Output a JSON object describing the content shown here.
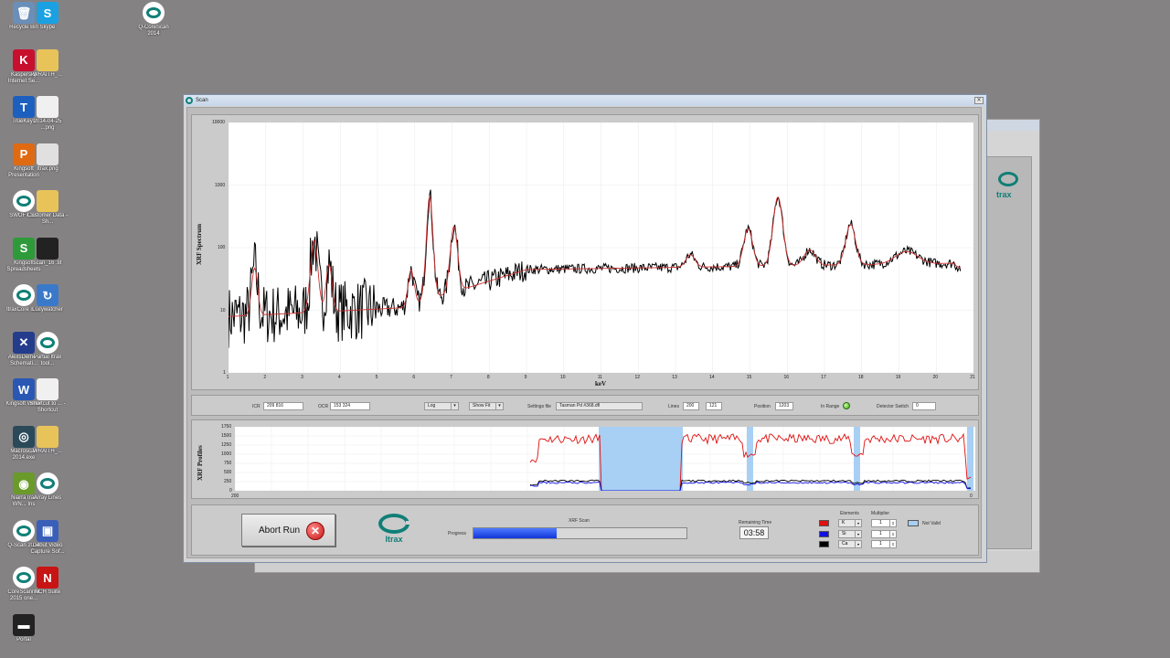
{
  "desktop": {
    "icons": [
      {
        "label": "Recycle Bin",
        "color": "#6a8fb8",
        "glyph": "🗑"
      },
      {
        "label": "Skype",
        "color": "#1ba1e2",
        "glyph": "S"
      },
      {
        "label": "Q-CoreScan 2014",
        "color": "itrax",
        "glyph": ""
      },
      {
        "label": "Kaspersky Internet Se...",
        "color": "#c8102e",
        "glyph": "K"
      },
      {
        "label": "WRAITH_...",
        "color": "#e7c35a",
        "glyph": ""
      },
      {
        "label": "TrueKeys",
        "color": "#1d5fbf",
        "glyph": "T"
      },
      {
        "label": "2014-04-25 ...png",
        "color": "#f0f0f0",
        "glyph": ""
      },
      {
        "label": "Kingsoft Presentation",
        "color": "#e06a12",
        "glyph": "P"
      },
      {
        "label": "Itrax.png",
        "color": "#e0e0e0",
        "glyph": ""
      },
      {
        "label": "SWOFT 3.0",
        "color": "itrax",
        "glyph": ""
      },
      {
        "label": "Customer Data - Sh...",
        "color": "#e7c35a",
        "glyph": ""
      },
      {
        "label": "Kingsoft Spreadsheets",
        "color": "#2e9a3a",
        "glyph": "S"
      },
      {
        "label": "scan_16 .tif",
        "color": "#222222",
        "glyph": ""
      },
      {
        "label": "ItraxCore 8.07",
        "color": "itrax",
        "glyph": ""
      },
      {
        "label": "Lucywatcher",
        "color": "#3a79c9",
        "glyph": "↻"
      },
      {
        "label": "AlexsDemo - Schemati...",
        "color": "#233c8c",
        "glyph": "✕"
      },
      {
        "label": "Partial Itrax tool...",
        "color": "itrax",
        "glyph": ""
      },
      {
        "label": "Kingsoft Writer",
        "color": "#2a57b4",
        "glyph": "W"
      },
      {
        "label": "Shortcut to ... - Shortcut",
        "color": "#f0f0f0",
        "glyph": ""
      },
      {
        "label": "Macroscan 2014.exe",
        "color": "#2a4a5a",
        "glyph": "◎"
      },
      {
        "label": "WRAITH_...",
        "color": "#e7c35a",
        "glyph": ""
      },
      {
        "label": "NiarraTrail WN... Ins",
        "color": "#6a9a2a",
        "glyph": "◉"
      },
      {
        "label": "Array Lines",
        "color": "itrax",
        "glyph": ""
      },
      {
        "label": "Q-Scan 2014",
        "color": "itrax",
        "glyph": ""
      },
      {
        "label": "Debut Video Capture Sof...",
        "color": "#3a5fb9",
        "glyph": "▣"
      },
      {
        "label": "CoreScanner 2015 one...",
        "color": "itrax",
        "glyph": ""
      },
      {
        "label": "NCH Suite",
        "color": "#c81414",
        "glyph": "N"
      },
      {
        "label": "Portal",
        "color": "#222222",
        "glyph": "▬"
      }
    ]
  },
  "window": {
    "title": "Scan",
    "close_glyph": "✕"
  },
  "spectrum": {
    "ylabel": "XRF Spectrum",
    "xlabel": "keV",
    "y_ticks": [
      "10000",
      "1000",
      "100",
      "10",
      "1"
    ],
    "x_ticks": [
      "1",
      "2",
      "3",
      "4",
      "5",
      "6",
      "7",
      "8",
      "9",
      "10",
      "11",
      "12",
      "13",
      "14",
      "15",
      "16",
      "17",
      "18",
      "19",
      "20",
      "21"
    ]
  },
  "controls": {
    "icr_label": "ICR",
    "icr_value": "209 816",
    "ocr_label": "OCR",
    "ocr_value": "153 324",
    "scale_value": "Log",
    "fit_value": "Show Fit",
    "settings_label": "Settings file",
    "settings_value": "Tasman Pd #368.dfl",
    "lines_label": "Lines",
    "lines_value1": "200",
    "lines_value2": "121",
    "position_label": "Position",
    "position_value": "1203",
    "in_range_label": "In Range",
    "detector_label": "Detector Switch",
    "detector_value": "0",
    "dropdown_glyph": "▾"
  },
  "profiles": {
    "ylabel": "XRF Profiles",
    "y_ticks": [
      "1750",
      "1500",
      "1250",
      "1000",
      "750",
      "500",
      "250",
      "0"
    ],
    "x_left": "200",
    "x_right": "0"
  },
  "bottom": {
    "abort_label": "Abort Run",
    "abort_glyph": "✕",
    "logo_text": "Itrax",
    "scan_label": "XRF Scan",
    "progress_label": "Progress",
    "progress_fraction": 0.39,
    "remaining_label": "Remaining Time",
    "remaining_value": "03:58",
    "elements_label": "Elements",
    "multiplier_label": "Multiplier",
    "not_valid_label": "Not Valid",
    "rows": [
      {
        "color": "#e01010",
        "element": "K",
        "multiplier": "1"
      },
      {
        "color": "#1010e0",
        "element": "Si",
        "multiplier": "1"
      },
      {
        "color": "#000000",
        "element": "Ca",
        "multiplier": "1"
      }
    ],
    "spin_glyph": "⇕"
  },
  "back_window": {
    "logo_text": "trax"
  },
  "colors": {
    "accent": "#0f7f77",
    "fit_line": "#d03030",
    "spectrum_line": "#000000",
    "invalid_band": "#a8d0f4"
  }
}
